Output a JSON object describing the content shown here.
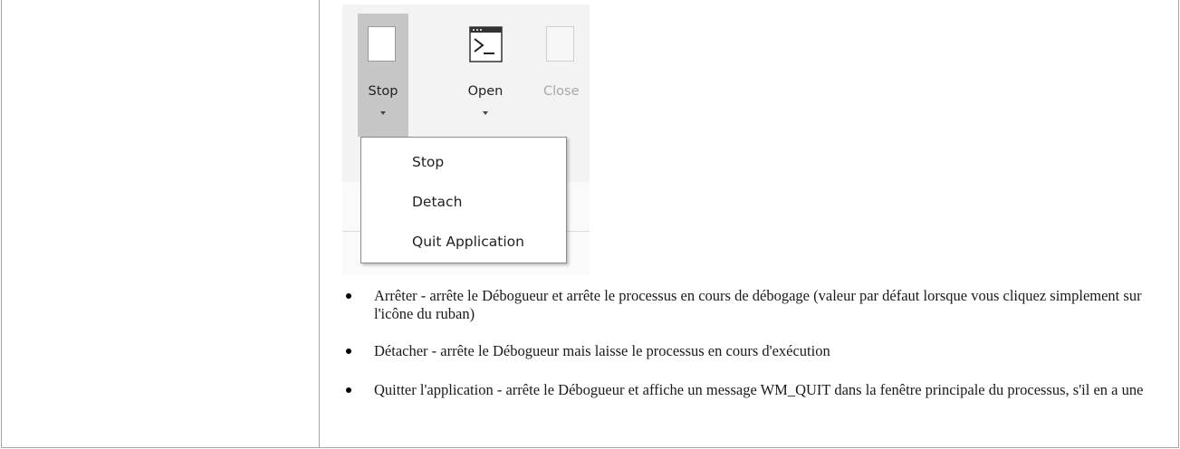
{
  "ribbon": {
    "buttons": {
      "stop": "Stop",
      "open": "Open",
      "close": "Close"
    },
    "stop_menu": [
      "Stop",
      "Detach",
      "Quit Application"
    ]
  },
  "bullets": [
    "Arrêter - arrête le Débogueur et arrête le processus en cours de débogage (valeur par défaut lorsque vous cliquez simplement sur l'icône du ruban)",
    "Détacher - arrête le Débogueur mais laisse le processus en cours d'exécution",
    "Quitter l'application - arrête le Débogueur et affiche un message WM_QUIT dans la fenêtre principale du processus, s'il en a une"
  ],
  "colors": {
    "pressed_button": "#c6c6c6",
    "ribbon_background": "#f3f3f3",
    "table_border": "#a6a6a6",
    "disabled_text": "#a8a8a8"
  }
}
